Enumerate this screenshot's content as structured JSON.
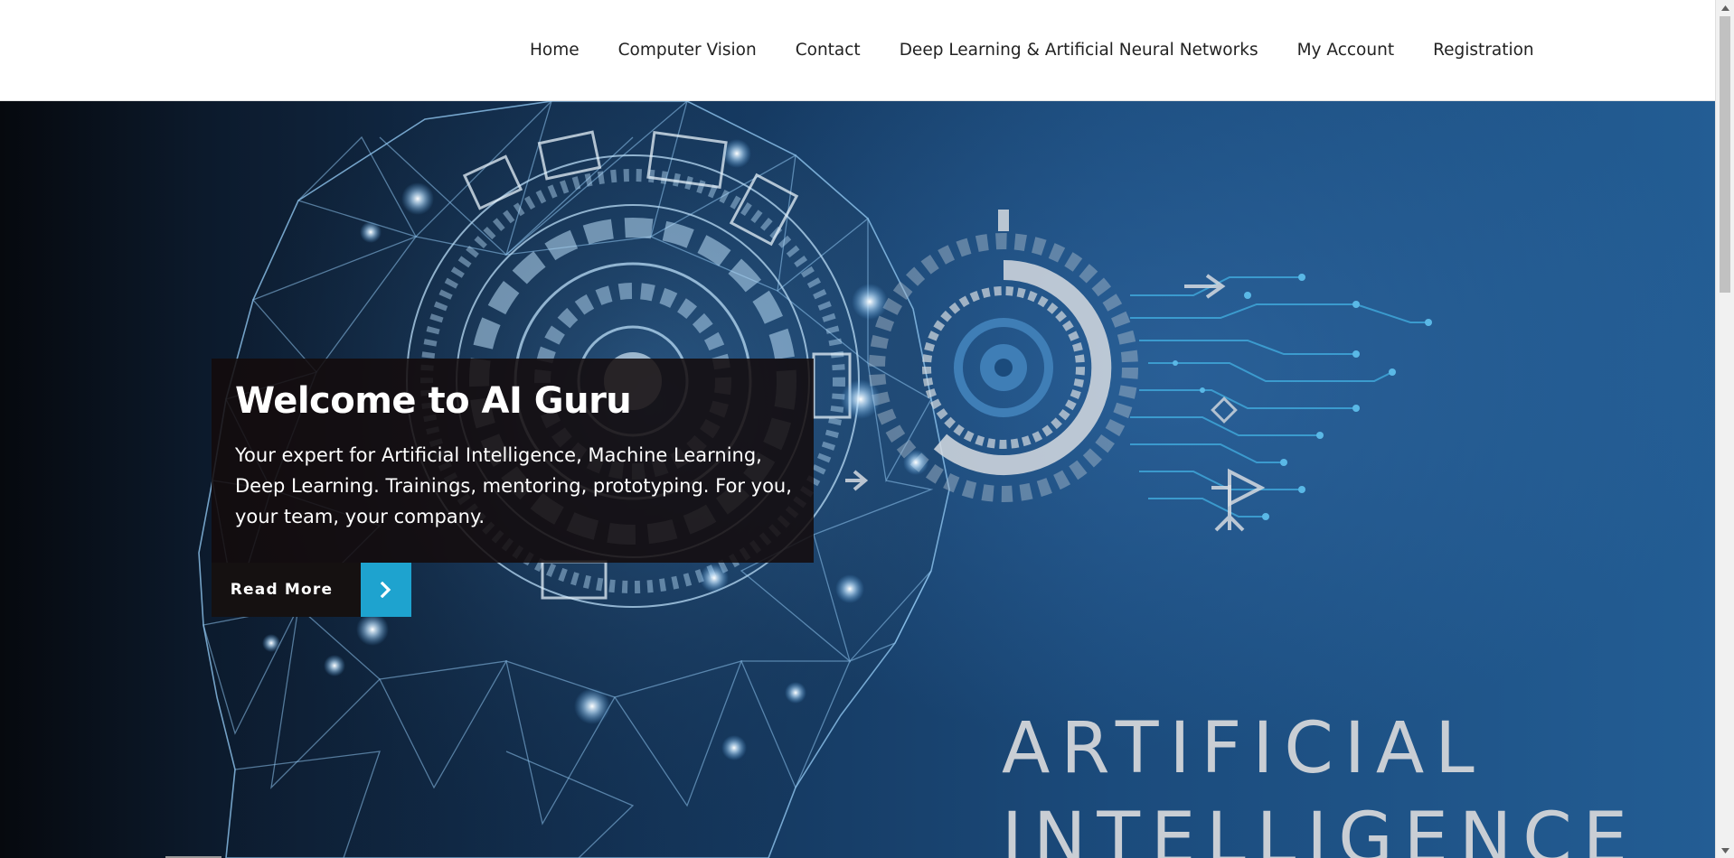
{
  "nav": {
    "items": [
      {
        "label": "Home"
      },
      {
        "label": "Computer Vision"
      },
      {
        "label": "Contact"
      },
      {
        "label": "Deep Learning & Artificial Neural Networks"
      },
      {
        "label": "My Account"
      },
      {
        "label": "Registration"
      }
    ]
  },
  "hero": {
    "title": "Welcome to AI Guru",
    "text": "Your expert for Artificial Intelligence, Machine Learning, Deep Learning. Trainings, mentoring, prototyping. For you, your team, your company.",
    "cta_label": "Read More",
    "cta_icon": "chevron-right-icon",
    "banner_line1": "ARTIFICIAL",
    "banner_line2": "INTELLIGENCE"
  },
  "colors": {
    "accent": "#1ea3cf",
    "caption_bg": "#140a0a",
    "hero_blue": "#1b4b7c"
  }
}
